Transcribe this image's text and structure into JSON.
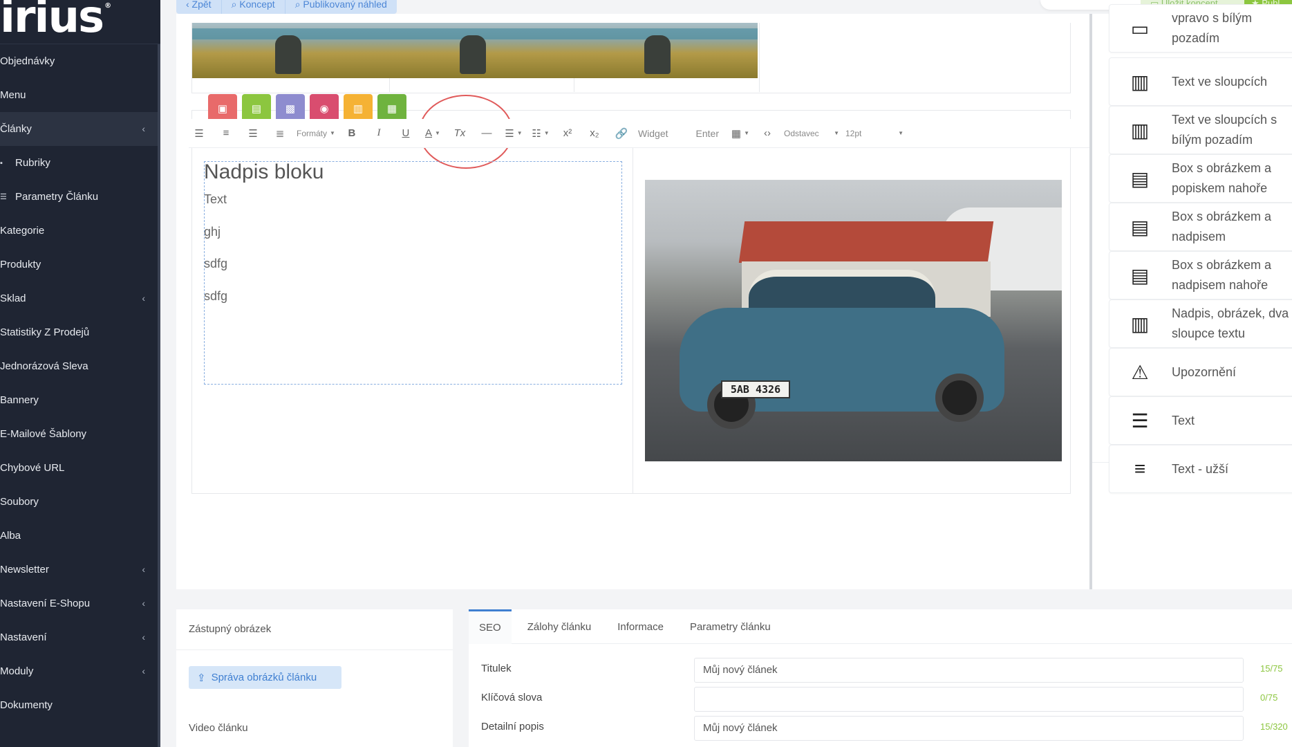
{
  "brand": {
    "logo_text": "irius",
    "logo_mark": "®"
  },
  "sidebar": {
    "items": [
      {
        "label": "Objednávky",
        "has_chevron": false,
        "active": false,
        "sub": false
      },
      {
        "label": "Menu",
        "has_chevron": false,
        "active": false,
        "sub": false
      },
      {
        "label": "Články",
        "has_chevron": true,
        "active": true,
        "sub": false
      },
      {
        "label": "Rubriky",
        "has_chevron": false,
        "active": false,
        "sub": true
      },
      {
        "label": "Parametry Článku",
        "has_chevron": false,
        "active": false,
        "sub": true
      },
      {
        "label": "Kategorie",
        "has_chevron": false,
        "active": false,
        "sub": false
      },
      {
        "label": "Produkty",
        "has_chevron": false,
        "active": false,
        "sub": false
      },
      {
        "label": "Sklad",
        "has_chevron": true,
        "active": false,
        "sub": false
      },
      {
        "label": "Statistiky Z Prodejů",
        "has_chevron": false,
        "active": false,
        "sub": false
      },
      {
        "label": "Jednorázová Sleva",
        "has_chevron": false,
        "active": false,
        "sub": false
      },
      {
        "label": "Bannery",
        "has_chevron": false,
        "active": false,
        "sub": false
      },
      {
        "label": "E-Mailové Šablony",
        "has_chevron": false,
        "active": false,
        "sub": false
      },
      {
        "label": "Chybové URL",
        "has_chevron": false,
        "active": false,
        "sub": false
      },
      {
        "label": "Soubory",
        "has_chevron": false,
        "active": false,
        "sub": false
      },
      {
        "label": "Alba",
        "has_chevron": false,
        "active": false,
        "sub": false
      },
      {
        "label": "Newsletter",
        "has_chevron": true,
        "active": false,
        "sub": false
      },
      {
        "label": "Nastavení E-Shopu",
        "has_chevron": true,
        "active": false,
        "sub": false
      },
      {
        "label": "Nastavení",
        "has_chevron": true,
        "active": false,
        "sub": false
      },
      {
        "label": "Moduly",
        "has_chevron": true,
        "active": false,
        "sub": false
      },
      {
        "label": "Dokumenty",
        "has_chevron": false,
        "active": false,
        "sub": false
      }
    ]
  },
  "topbar": {
    "back_label": "‹ Zpět",
    "draft_label": "Koncept",
    "published_label": "Publikovaný náhled",
    "save_draft_label": "Uložit koncept",
    "publish_label": "Publ"
  },
  "widgets": [
    {
      "name": "image-widget",
      "color": "#e86a6a",
      "icon": "image-icon"
    },
    {
      "name": "file-widget",
      "color": "#8cc63f",
      "icon": "file-icon"
    },
    {
      "name": "gallery-widget",
      "color": "#8e8ccf",
      "icon": "gallery-icon"
    },
    {
      "name": "camera-widget",
      "color": "#d94d6f",
      "icon": "camera-icon"
    },
    {
      "name": "chart-widget",
      "color": "#f5b234",
      "icon": "chart-icon"
    },
    {
      "name": "table-widget",
      "color": "#6fb33e",
      "icon": "table-icon"
    }
  ],
  "toolbar": {
    "formats_label": "Formáty",
    "widget_label": "Widget",
    "enter_label": "Enter",
    "paragraph_label": "Odstavec",
    "size_label": "12pt",
    "superscript_label": "x²",
    "subscript_label": "x₂"
  },
  "content": {
    "block_title": "Nadpis bloku",
    "paragraphs": [
      "Text",
      "ghj",
      "sdfg",
      "sdfg"
    ],
    "plate_text": "5AB 4326"
  },
  "rpanel": {
    "items": [
      {
        "label_1": "vpravo s bílým",
        "label_2": "pozadím",
        "icon": "image-right-icon"
      },
      {
        "label_1": "Text ve sloupcích",
        "label_2": "",
        "icon": "columns-icon"
      },
      {
        "label_1": "Text ve sloupcích s",
        "label_2": "bílým pozadím",
        "icon": "columns-box-icon"
      },
      {
        "label_1": "Box s obrázkem a",
        "label_2": "popiskem nahoře",
        "icon": "box-image-top-icon"
      },
      {
        "label_1": "Box s obrázkem a",
        "label_2": "nadpisem",
        "icon": "box-image-title-icon"
      },
      {
        "label_1": "Box s obrázkem a",
        "label_2": "nadpisem nahoře",
        "icon": "box-image-title-top-icon"
      },
      {
        "label_1": "Nadpis, obrázek, dva",
        "label_2": "sloupce textu",
        "icon": "heading-columns-icon"
      },
      {
        "label_1": "Upozornění",
        "label_2": "",
        "icon": "warning-icon"
      },
      {
        "label_1": "Text",
        "label_2": "",
        "icon": "text-icon"
      },
      {
        "label_1": "Text - užší",
        "label_2": "",
        "icon": "text-narrow-icon"
      }
    ]
  },
  "bottom": {
    "placeholder_image_label": "Zástupný obrázek",
    "manage_images_label": "Správa obrázků článku",
    "video_label": "Video článku",
    "tabs": [
      "SEO",
      "Zálohy článku",
      "Informace",
      "Parametry článku"
    ],
    "fields": [
      {
        "label": "Titulek",
        "value": "Můj nový článek",
        "count": "15/75"
      },
      {
        "label": "Klíčová slova",
        "value": "",
        "count": "0/75"
      },
      {
        "label": "Detailní popis",
        "value": "Můj nový článek",
        "count": "15/320"
      }
    ]
  }
}
